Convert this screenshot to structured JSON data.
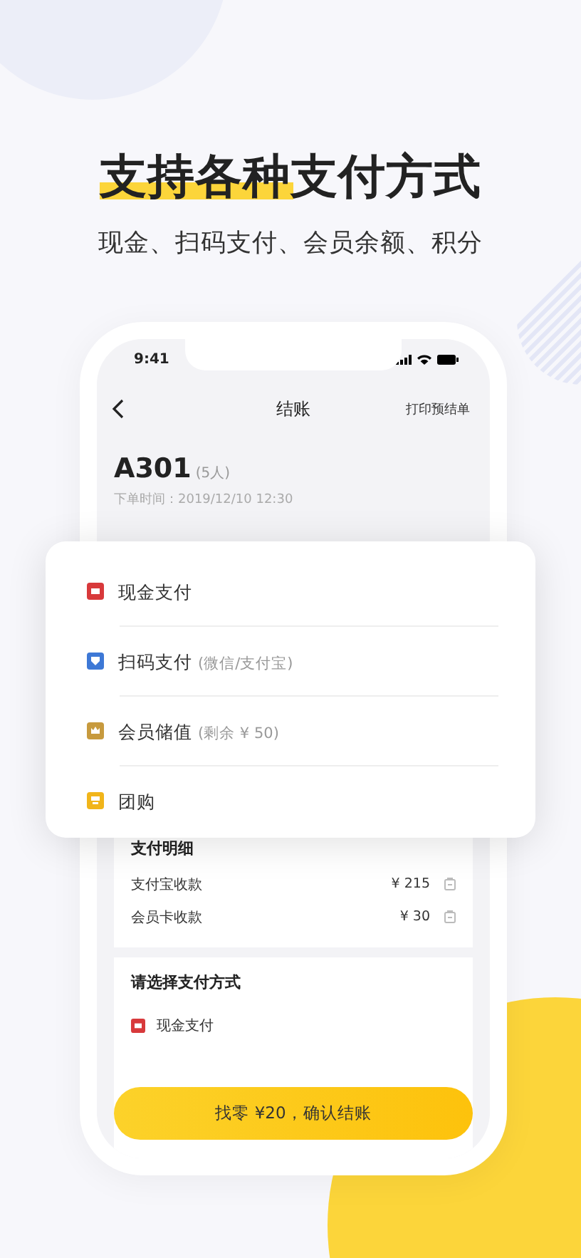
{
  "headline": "支持各种支付方式",
  "subtitle": "现金、扫码支付、会员余额、积分",
  "phone": {
    "status_time": "9:41",
    "nav": {
      "title": "结账",
      "action": "打印预结单"
    },
    "order": {
      "table": "A301",
      "guests": "(5人)",
      "time": "下单时间：2019/12/10 12:30"
    },
    "details": {
      "title": "支付明细",
      "rows": [
        {
          "label": "支付宝收款",
          "amount": "¥ 215"
        },
        {
          "label": "会员卡收款",
          "amount": "¥ 30"
        }
      ]
    },
    "select": {
      "title": "请选择支付方式",
      "options": [
        {
          "kind": "cash",
          "label": "现金支付"
        }
      ]
    },
    "confirm_button": "找零 ¥20，确认结账"
  },
  "payment_menu": [
    {
      "kind": "cash",
      "label": "现金支付"
    },
    {
      "kind": "scan",
      "label": "扫码支付",
      "note": "(微信/支付宝)"
    },
    {
      "kind": "member",
      "label": "会员储值",
      "note": "(剩余 ¥ 50)"
    },
    {
      "kind": "group",
      "label": "团购"
    }
  ]
}
